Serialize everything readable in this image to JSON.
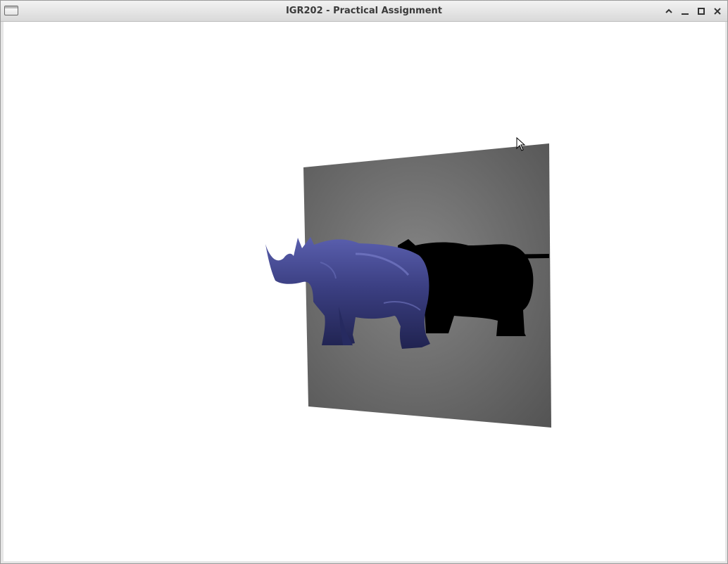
{
  "window": {
    "title": "IGR202 - Practical Assignment"
  },
  "controls": {
    "shade": "shade-icon",
    "minimize": "minimize-icon",
    "maximize": "maximize-icon",
    "close": "close-icon"
  },
  "scene": {
    "background_color": "#ffffff",
    "plane_color": "#6e6e6e",
    "model_color": "#3b3f82",
    "shadow_color": "#000000",
    "model": "rhino"
  }
}
